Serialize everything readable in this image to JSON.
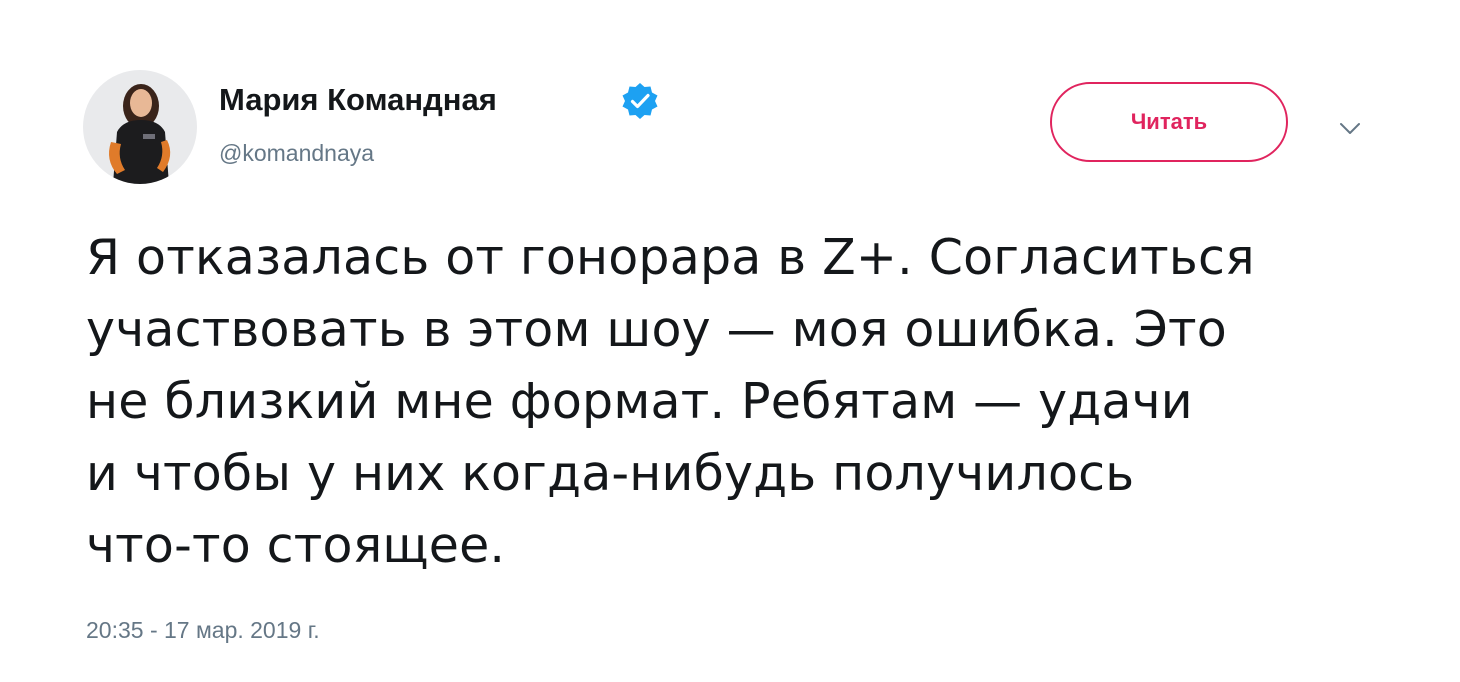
{
  "author": {
    "display_name": "Мария Командная",
    "handle": "@komandnaya",
    "verified": true,
    "avatar_icon": "profile-photo"
  },
  "follow_button": {
    "label": "Читать",
    "color": "#e0245e"
  },
  "menu_caret_icon": "chevron-down-icon",
  "verified_icon": "verified-badge-icon",
  "verified_color": "#1da1f2",
  "tweet": {
    "text_lines": [
      "Я отказалась от гонорара в Z+. Согласиться",
      "участвовать в этом шоу — моя ошибка. Это",
      "не близкий мне формат. Ребятам — удачи",
      "и чтобы у них когда-нибудь получилось",
      "что-то стоящее."
    ],
    "timestamp": "20:35 - 17 мар. 2019 г."
  }
}
